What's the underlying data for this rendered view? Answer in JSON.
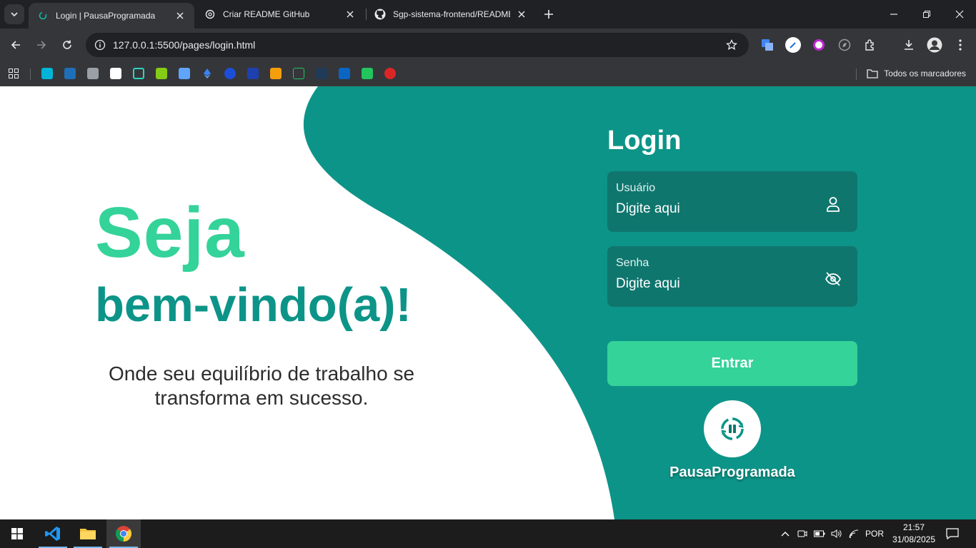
{
  "browser": {
    "tabs": [
      {
        "title": "Login | PausaProgramada",
        "active": true
      },
      {
        "title": "Criar README GitHub",
        "active": false
      },
      {
        "title": "Sgp-sistema-frontend/README",
        "active": false
      }
    ],
    "url": "127.0.0.1:5500/pages/login.html",
    "bookmarks_all_label": "Todos os marcadores"
  },
  "hero": {
    "title_line1": "Seja",
    "title_line2": "bem-vindo(a)!",
    "subtitle": "Onde seu equilíbrio de trabalho se transforma em sucesso."
  },
  "login": {
    "title": "Login",
    "username": {
      "label": "Usuário",
      "placeholder": "Digite aqui"
    },
    "password": {
      "label": "Senha",
      "placeholder": "Digite aqui"
    },
    "submit_label": "Entrar",
    "brand_name": "PausaProgramada"
  },
  "taskbar": {
    "language": "POR",
    "time": "21:57",
    "date": "31/08/2025"
  },
  "colors": {
    "teal_dark": "#0d9488",
    "teal_panel": "#0f766e",
    "mint": "#34d399",
    "white": "#ffffff"
  }
}
